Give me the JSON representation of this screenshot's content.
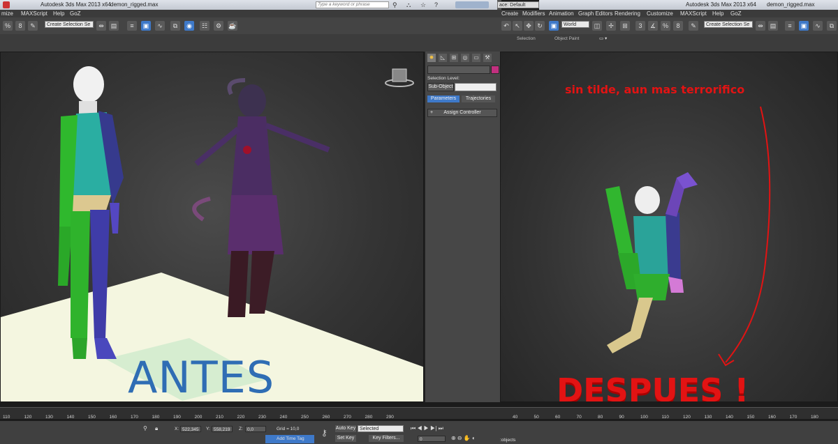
{
  "left_window": {
    "title_app": "Autodesk 3ds Max  2013 x64",
    "title_file": "demon_rigged.max",
    "search_placeholder": "Type a keyword or phrase",
    "workspace_label": "ace: Default",
    "menu": [
      "mize",
      "MAXScript",
      "Help",
      "GoZ"
    ],
    "selection_set_placeholder": "Create Selection Se",
    "command_panel": {
      "selection_level_label": "Selection Level:",
      "sub_object_label": "Sub-Object",
      "tab_parameters": "Parameters",
      "tab_trajectories": "Trajectories",
      "rollout_toggle": "+",
      "assign_controller": "Assign Controller",
      "object_color": "#c2307f"
    },
    "viewport_caption": "ANTES",
    "timeline_ticks": [
      "110",
      "120",
      "130",
      "140",
      "150",
      "160",
      "170",
      "180",
      "190",
      "200",
      "210",
      "220",
      "230",
      "240",
      "250",
      "260",
      "270",
      "280",
      "290"
    ],
    "status": {
      "x_label": "X:",
      "x_value": "522,345",
      "y_label": "Y:",
      "y_value": "558,219",
      "z_label": "Z:",
      "z_value": "0,0",
      "grid": "Grid = 10,0",
      "add_time_tag": "Add Time Tag",
      "auto_key": "Auto Key",
      "set_key": "Set Key",
      "selected": "Selected",
      "key_filters": "Key Filters...",
      "frame": "0"
    }
  },
  "right_window": {
    "title_app": "Autodesk 3ds Max  2013 x64",
    "title_file": "demon_rigged.max",
    "menu": [
      "Create",
      "Modifiers",
      "Animation",
      "Graph Editors",
      "Rendering",
      "Customize",
      "MAXScript",
      "Help",
      "GoZ"
    ],
    "coord_system": "World",
    "selection_set_placeholder": "Create Selection Se",
    "ribbon_tabs": [
      "Selection",
      "Object Paint"
    ],
    "annotation_text": "sin tilde, aun mas terrorifico",
    "viewport_caption": "DESPUES !",
    "timeline_ticks": [
      "40",
      "50",
      "60",
      "70",
      "80",
      "90",
      "100",
      "110",
      "120",
      "130",
      "140",
      "150",
      "160",
      "170",
      "180"
    ],
    "status_text": ":objects"
  },
  "colors": {
    "annotation_red": "#e21313",
    "antes_blue": "#2f6db4",
    "active_tab_blue": "#3e79c9"
  }
}
